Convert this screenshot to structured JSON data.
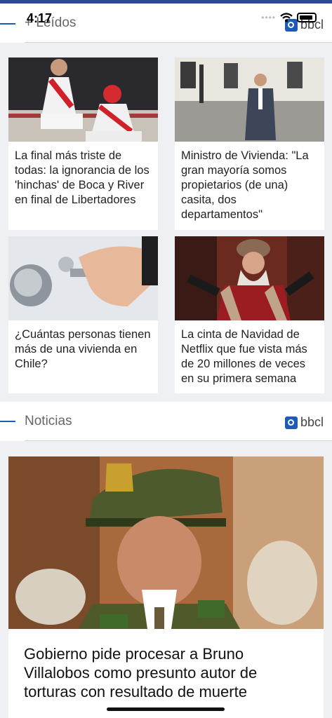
{
  "status_bar": {
    "time": "4:17",
    "signal_dots": "••••"
  },
  "sections": [
    {
      "title": "+ Leídos",
      "brand": "bbcl"
    },
    {
      "title": "Noticias",
      "brand": "bbcl"
    }
  ],
  "most_read": [
    {
      "headline": "La final más triste de todas: la ignorancia de los 'hinchas' de Boca y River en final de Libertadores",
      "image": "football-fans-photo"
    },
    {
      "headline": "Ministro de Vivienda: \"La gran mayoría somos propietarios (de una) casita, dos departamentos\"",
      "image": "minister-photo"
    },
    {
      "headline": "¿Cuántas personas tienen más de una vivienda en Chile?",
      "image": "key-in-lock-photo"
    },
    {
      "headline": "La cinta de Navidad de Netflix que fue vista más de 20 millones de veces en su primera semana",
      "image": "santa-claus-photo"
    }
  ],
  "news": [
    {
      "headline": "Gobierno pide procesar a Bruno Villalobos como presunto autor de torturas con resultado de muerte",
      "image": "police-general-photo"
    }
  ],
  "colors": {
    "accent": "#1e5bb8",
    "top_bar": "#2c4a8a",
    "background": "#eef0f4"
  }
}
